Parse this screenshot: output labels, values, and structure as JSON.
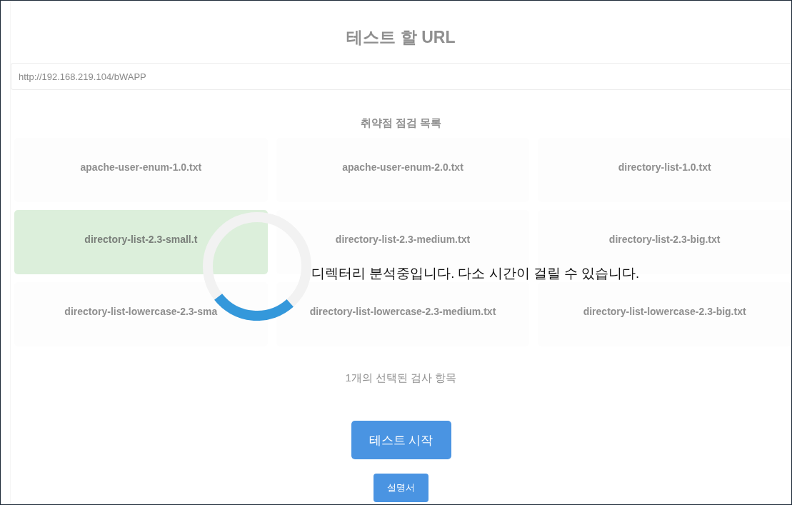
{
  "url_section": {
    "title": "테스트 할 URL",
    "url_input": {
      "value": "http://192.168.219.104/bWAPP"
    }
  },
  "wordlists": {
    "title": "취약점 점검 목록",
    "items": [
      {
        "label": "apache-user-enum-1.0.txt",
        "selected": false
      },
      {
        "label": "apache-user-enum-2.0.txt",
        "selected": false
      },
      {
        "label": "directory-list-1.0.txt",
        "selected": false
      },
      {
        "label": "directory-list-2.3-small.t",
        "selected": true
      },
      {
        "label": "directory-list-2.3-medium.txt",
        "selected": false
      },
      {
        "label": "directory-list-2.3-big.txt",
        "selected": false
      },
      {
        "label": "directory-list-lowercase-2.3-sma",
        "selected": false
      },
      {
        "label": "directory-list-lowercase-2.3-medium.txt",
        "selected": false
      },
      {
        "label": "directory-list-lowercase-2.3-big.txt",
        "selected": false
      }
    ]
  },
  "selection_summary": "1개의 선택된 검사 항목",
  "buttons": [
    {
      "label": "테스트 시작",
      "kind": "primary"
    },
    {
      "label": "설명서",
      "kind": "secondary"
    }
  ],
  "loading": {
    "message": "디렉터리 분석중입니다. 다소 시간이 걸릴 수 있습니다."
  }
}
